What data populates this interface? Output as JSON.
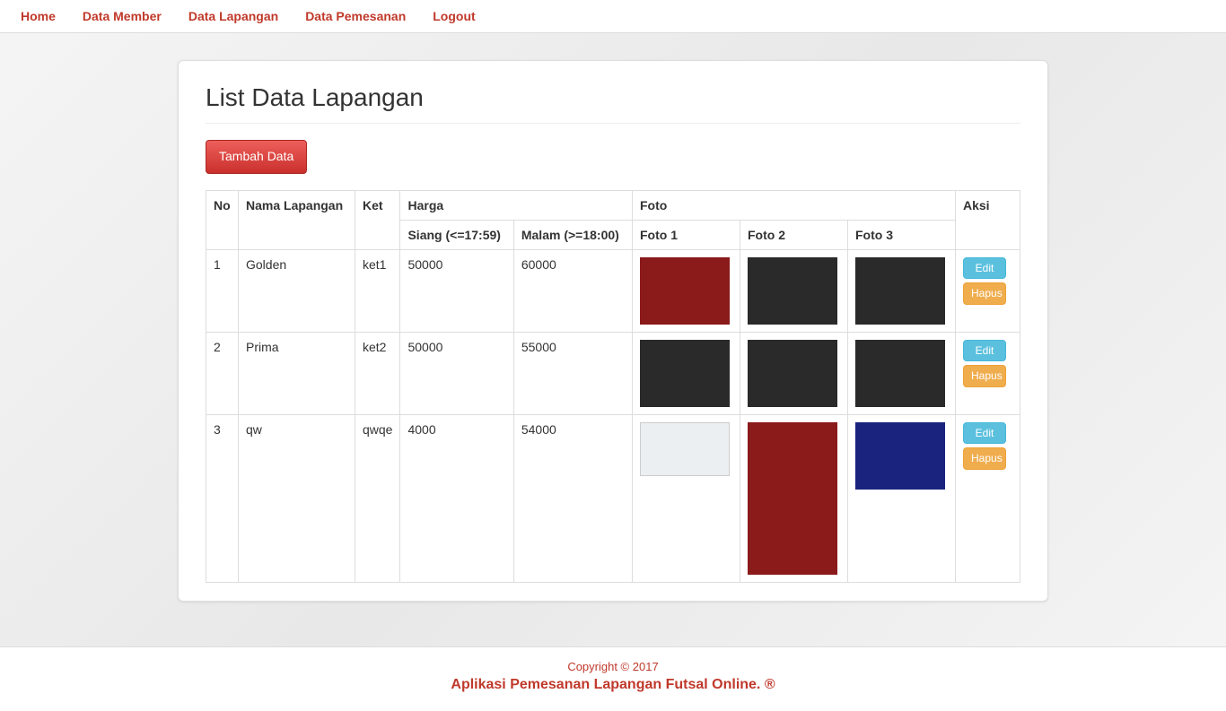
{
  "nav": {
    "home": "Home",
    "member": "Data Member",
    "lapangan": "Data Lapangan",
    "pemesanan": "Data Pemesanan",
    "logout": "Logout"
  },
  "page": {
    "title": "List Data Lapangan",
    "add_button": "Tambah Data"
  },
  "table": {
    "headers": {
      "no": "No",
      "nama": "Nama Lapangan",
      "ket": "Ket",
      "harga": "Harga",
      "siang": "Siang (<=17:59)",
      "malam": "Malam (>=18:00)",
      "foto": "Foto",
      "foto1": "Foto 1",
      "foto2": "Foto 2",
      "foto3": "Foto 3",
      "aksi": "Aksi"
    },
    "rows": [
      {
        "no": "1",
        "nama": "Golden",
        "ket": "ket1",
        "siang": "50000",
        "malam": "60000"
      },
      {
        "no": "2",
        "nama": "Prima",
        "ket": "ket2",
        "siang": "50000",
        "malam": "55000"
      },
      {
        "no": "3",
        "nama": "qw",
        "ket": "qwqe",
        "siang": "4000",
        "malam": "54000"
      }
    ],
    "actions": {
      "edit": "Edit",
      "hapus": "Hapus"
    }
  },
  "footer": {
    "copyright": "Copyright © 2017",
    "appname": "Aplikasi Pemesanan Lapangan Futsal Online. ®"
  }
}
